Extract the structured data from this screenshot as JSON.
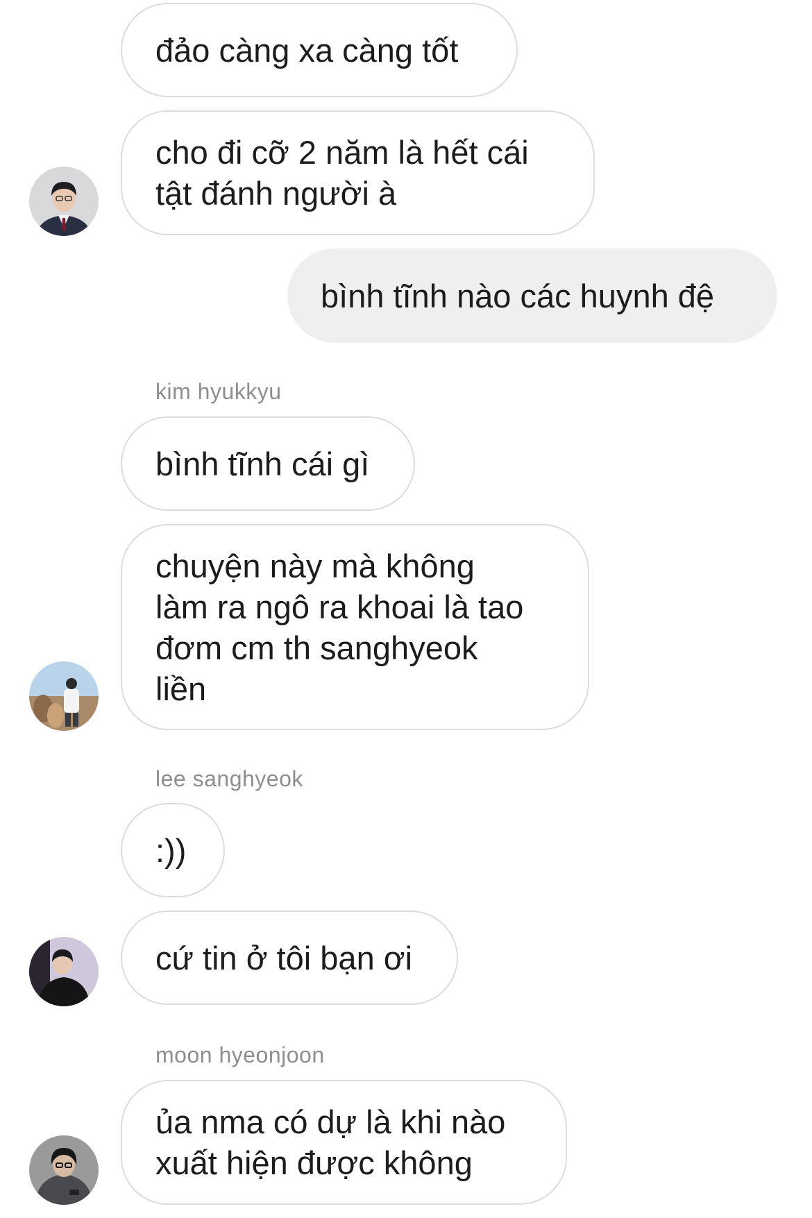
{
  "messages": [
    {
      "text": "đảo càng xa càng tốt"
    },
    {
      "text": "cho đi cỡ 2 năm là hết cái\ntật đánh người à"
    },
    {
      "text": "bình tĩnh nào các huynh đệ"
    },
    {
      "sender": "kim hyukkyu",
      "text": "bình tĩnh cái gì"
    },
    {
      "text": "chuyện này mà không\nlàm ra ngô ra khoai là tao\nđơm cm th sanghyeok\nliền"
    },
    {
      "sender": "lee sanghyeok",
      "text": ":))"
    },
    {
      "text": "cứ tin ở tôi bạn ơi"
    },
    {
      "sender": "moon hyeonjoon",
      "text": "ủa nma có dự là khi nào\nxuất hiện được không"
    }
  ],
  "avatars": [
    {
      "name": "profile-photo-suit"
    },
    {
      "name": "profile-photo-outdoor-alpacas"
    },
    {
      "name": "profile-photo-dark-hoodie"
    },
    {
      "name": "profile-photo-glasses-phone"
    }
  ]
}
